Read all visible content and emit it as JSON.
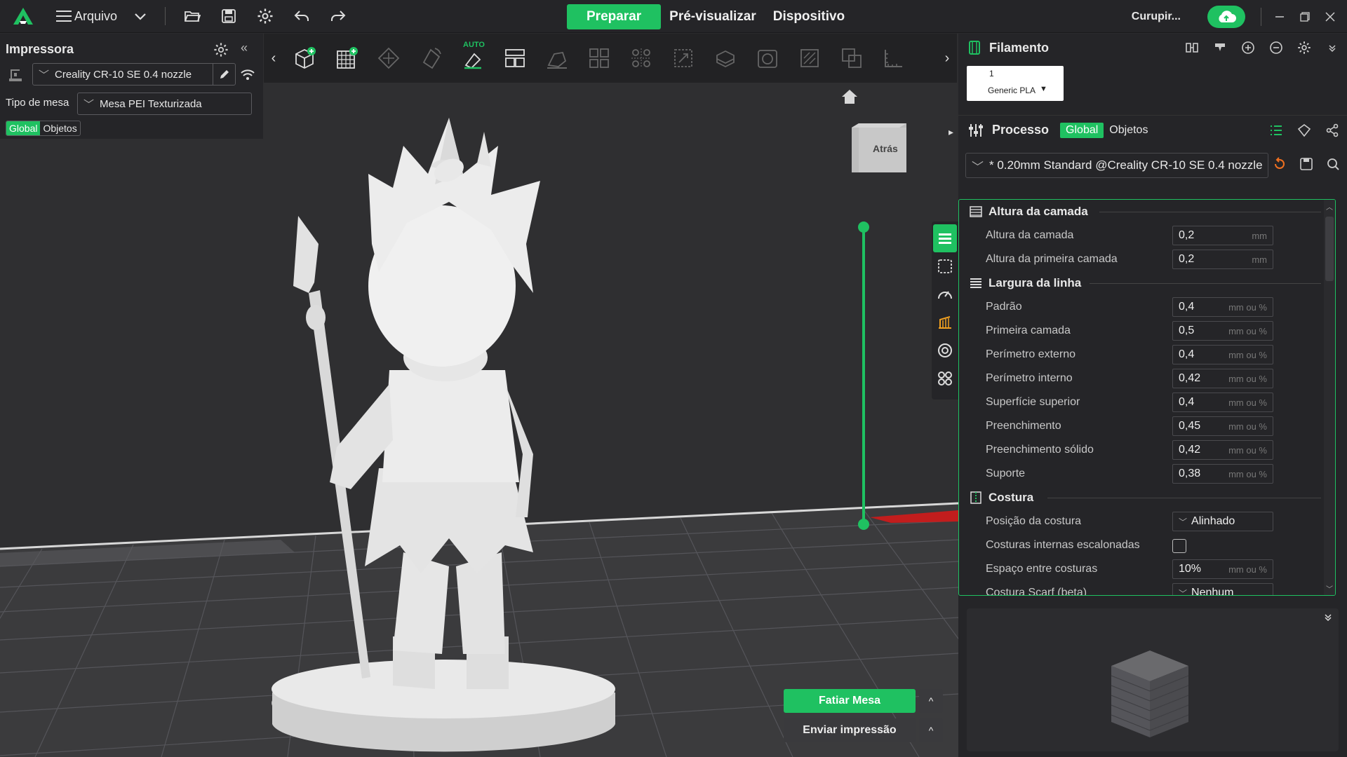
{
  "topbar": {
    "file_menu": "Arquivo",
    "tabs": [
      "Preparar",
      "Pré-visualizar",
      "Dispositivo"
    ],
    "active_tab": 0,
    "user": "Curupir...",
    "accent": "#1fc161"
  },
  "printer": {
    "title": "Impressora",
    "name": "Creality CR-10 SE 0.4 nozzle",
    "bed_label": "Tipo de mesa",
    "bed": "Mesa PEI Texturizada",
    "scope": [
      "Global",
      "Objetos"
    ]
  },
  "viewport": {
    "view_label": "Atrás",
    "auto_label": "AUTO",
    "slice_button": "Fatiar Mesa",
    "print_button": "Enviar impressão"
  },
  "filament": {
    "title": "Filamento",
    "slot_number": "1",
    "name": "Generic PLA"
  },
  "process": {
    "title": "Processo",
    "tabs": [
      "Global",
      "Objetos"
    ],
    "preset": "* 0.20mm Standard @Creality CR-10 SE 0.4 nozzle",
    "groups": [
      {
        "title": "Altura da camada",
        "rows": [
          {
            "label": "Altura da camada",
            "value": "0,2",
            "unit": "mm"
          },
          {
            "label": "Altura da primeira camada",
            "value": "0,2",
            "unit": "mm"
          }
        ]
      },
      {
        "title": "Largura da linha",
        "rows": [
          {
            "label": "Padrão",
            "value": "0,4",
            "unit": "mm ou %"
          },
          {
            "label": "Primeira camada",
            "value": "0,5",
            "unit": "mm ou %"
          },
          {
            "label": "Perímetro externo",
            "value": "0,4",
            "unit": "mm ou %"
          },
          {
            "label": "Perímetro interno",
            "value": "0,42",
            "unit": "mm ou %"
          },
          {
            "label": "Superfície superior",
            "value": "0,4",
            "unit": "mm ou %"
          },
          {
            "label": "Preenchimento",
            "value": "0,45",
            "unit": "mm ou %"
          },
          {
            "label": "Preenchimento sólido",
            "value": "0,42",
            "unit": "mm ou %"
          },
          {
            "label": "Suporte",
            "value": "0,38",
            "unit": "mm ou %"
          }
        ]
      },
      {
        "title": "Costura",
        "rows": [
          {
            "label": "Posição da costura",
            "value": "Alinhado",
            "unit": "",
            "type": "select"
          },
          {
            "label": "Costuras internas escalonadas",
            "value": "",
            "unit": "",
            "type": "checkbox"
          },
          {
            "label": "Espaço entre costuras",
            "value": "10%",
            "unit": "mm ou %"
          },
          {
            "label": "Costura Scarf (beta)",
            "value": "Nenhum",
            "unit": "",
            "type": "select"
          }
        ]
      }
    ]
  }
}
